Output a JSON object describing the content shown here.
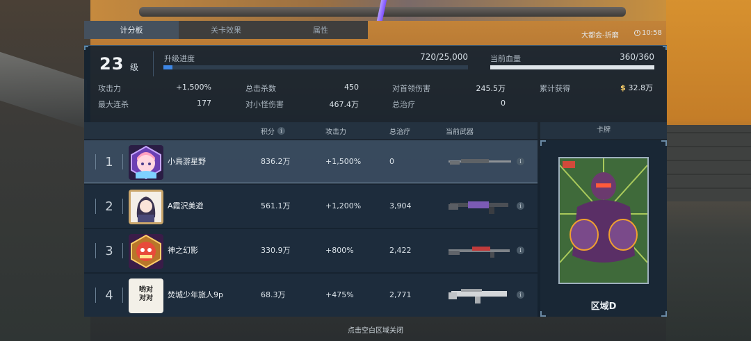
{
  "tabs": [
    "计分板",
    "关卡效果",
    "属性"
  ],
  "location": "大都会-折磨",
  "clock": "10:58",
  "level": {
    "value": "23",
    "unit": "级"
  },
  "xp": {
    "label": "升级进度",
    "value": "720/25,000",
    "progress": 0.0288
  },
  "hp": {
    "label": "当前血量",
    "value": "360/360",
    "progress": 1.0
  },
  "stats": {
    "attack": {
      "label": "攻击力",
      "value": "+1,500%"
    },
    "max_combo": {
      "label": "最大连杀",
      "value": "177"
    },
    "total_kills": {
      "label": "总击杀数",
      "value": "450"
    },
    "minion_damage": {
      "label": "对小怪伤害",
      "value": "467.4万"
    },
    "boss_damage": {
      "label": "对首领伤害",
      "value": "245.5万"
    },
    "total_heal": {
      "label": "总治疗",
      "value": "0"
    },
    "earned": {
      "label": "累计获得",
      "value": "32.8万",
      "currency_symbol": "$"
    }
  },
  "table": {
    "headers": {
      "score": "积分",
      "attack": "攻击力",
      "heal": "总治疗",
      "weapon": "当前武器",
      "card": "卡牌"
    },
    "rows": [
      {
        "rank": "1",
        "name": "小鳥游星野",
        "score": "836.2万",
        "attack": "+1,500%",
        "heal": "0"
      },
      {
        "rank": "2",
        "name": "A霞沢美遊",
        "score": "561.1万",
        "attack": "+1,200%",
        "heal": "3,904"
      },
      {
        "rank": "3",
        "name": "神之幻影",
        "score": "330.9万",
        "attack": "+800%",
        "heal": "2,422"
      },
      {
        "rank": "4",
        "name": "焚城少年旅人9p",
        "score": "68.3万",
        "attack": "+475%",
        "heal": "2,771"
      }
    ]
  },
  "avatar4_text": "哟对\n对对",
  "card": {
    "name": "区域D"
  },
  "close_hint": "点击空白区域关闭",
  "colors": {
    "accent_blue": "#3d86e4",
    "gold": "#ffd36b",
    "panel": "#142230"
  }
}
